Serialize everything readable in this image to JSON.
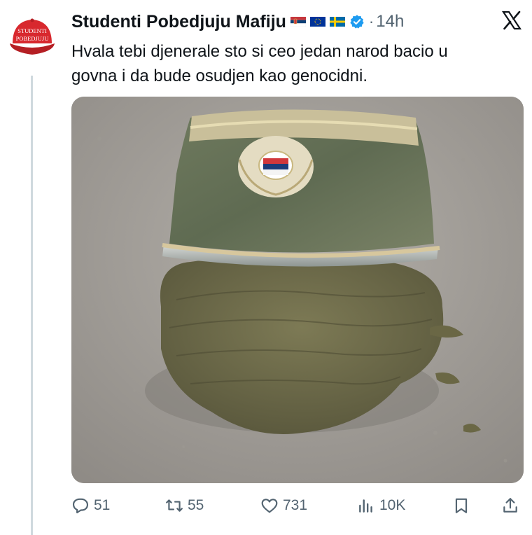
{
  "author": {
    "name": "Studenti Pobedjuju Mafiju",
    "avatar_text_line1": "STUDENTI",
    "avatar_text_line2": "POBEDJUJU",
    "flags": [
      "serbia-flag-icon",
      "eu-flag-icon",
      "sweden-flag-icon"
    ],
    "verified": true
  },
  "meta": {
    "separator": "·",
    "time": "14h"
  },
  "tweet": {
    "text_line1": "Hvala tebi djenerale sto si ceo jedan narod bacio u",
    "text_line2": "govna i da bude osudjen kao genocidni."
  },
  "media": {
    "description_icons": [
      "military-cap",
      "dung-pile",
      "asphalt-ground"
    ]
  },
  "actions": {
    "replies": "51",
    "reposts": "55",
    "likes": "731",
    "views": "10K"
  },
  "colors": {
    "text": "#0f1419",
    "muted": "#536471",
    "verified_blue": "#1d9bf0",
    "avatar_red": "#d8282e"
  }
}
